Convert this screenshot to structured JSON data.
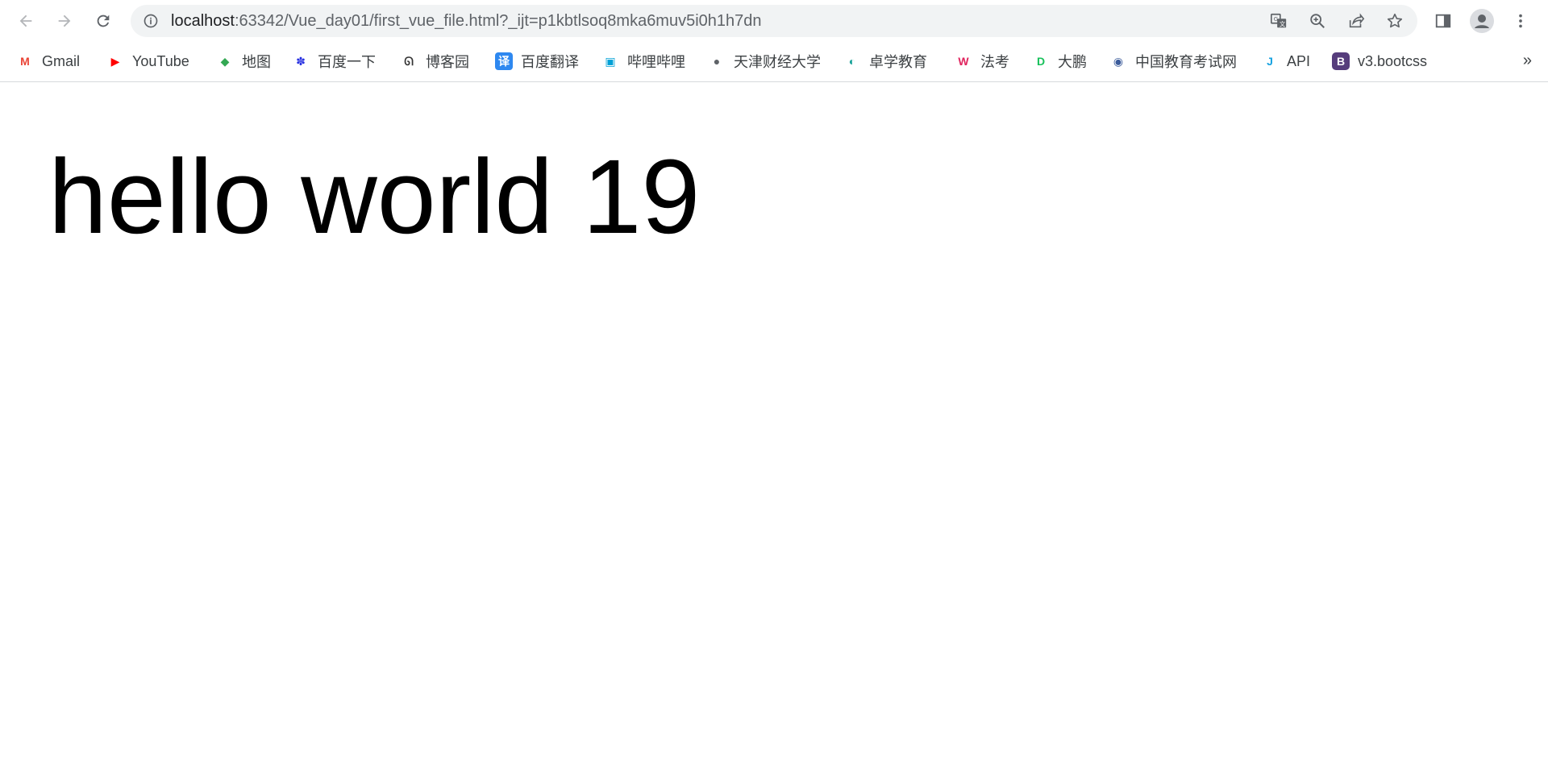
{
  "browser": {
    "url_host": "localhost",
    "url_rest": ":63342/Vue_day01/first_vue_file.html?_ijt=p1kbtlsoq8mka6muv5i0h1h7dn",
    "more_bookmarks": "»"
  },
  "bookmarks": [
    {
      "label": "Gmail",
      "icon": "gmail-icon",
      "glyph": "M",
      "color": "#ea4335"
    },
    {
      "label": "YouTube",
      "icon": "youtube-icon",
      "glyph": "▶",
      "color": "#ff0000"
    },
    {
      "label": "地图",
      "icon": "maps-icon",
      "glyph": "◆",
      "color": "#34a853"
    },
    {
      "label": "百度一下",
      "icon": "baidu-icon",
      "glyph": "✽",
      "color": "#2932e1"
    },
    {
      "label": "博客园",
      "icon": "cnblogs-icon",
      "glyph": "ᘏ",
      "color": "#333333"
    },
    {
      "label": "百度翻译",
      "icon": "baidu-translate-icon",
      "glyph": "译",
      "color": "#2e88f0"
    },
    {
      "label": "哔哩哔哩",
      "icon": "bilibili-icon",
      "glyph": "▣",
      "color": "#00a1d6"
    },
    {
      "label": "天津财经大学",
      "icon": "globe-icon",
      "glyph": "●",
      "color": "#5f6368"
    },
    {
      "label": "卓学教育",
      "icon": "zhuoxue-icon",
      "glyph": "◐",
      "color": "#1aa39a"
    },
    {
      "label": "法考",
      "icon": "fakao-icon",
      "glyph": "W",
      "color": "#e0245e"
    },
    {
      "label": "大鹏",
      "icon": "dapeng-icon",
      "glyph": "D",
      "color": "#18c15b"
    },
    {
      "label": "中国教育考试网",
      "icon": "neea-icon",
      "glyph": "◉",
      "color": "#3b5b9a"
    },
    {
      "label": "API",
      "icon": "api-icon",
      "glyph": "J",
      "color": "#17a2e0"
    },
    {
      "label": "v3.bootcss",
      "icon": "bootstrap-icon",
      "glyph": "B",
      "color": "#563d7c"
    }
  ],
  "page": {
    "headline": "hello world 19"
  }
}
